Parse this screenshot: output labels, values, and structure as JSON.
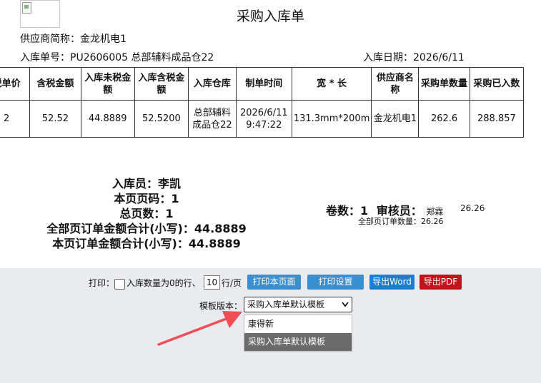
{
  "title": "采购入库单",
  "supplier_line": "供应商简称：金龙机电1",
  "order_line": "入库单号：PU2606005 总部辅料成品仓22",
  "date_line": "入库日期：2026/6/11",
  "table": {
    "headers": [
      "税单价",
      "含税金额",
      "入库未税金额",
      "入库含税金额",
      "入库仓库",
      "制单时间",
      "宽 * 长",
      "供应商名称",
      "采购单数量",
      "采购已入数"
    ],
    "row": [
      "2",
      "52.52",
      "44.8889",
      "52.5200",
      "总部辅料成品仓22",
      "2026/6/11 9:47:22",
      "131.3mm*200m",
      "金龙机电1",
      "262.6",
      "288.857"
    ]
  },
  "summary": {
    "receiver": "入库员：李凯",
    "page_no": "本页页码：1",
    "page_total": "总页数：1",
    "all_total": "全部页订单金额合计(小写)：44.8889",
    "page_total_amount": "本页订单金额合计(小写)：44.8889",
    "rolls_label": "卷数：",
    "rolls_value": "1",
    "auditor_label": "审核员：",
    "auditor_name": "郑霖",
    "auditor_num": "26.26",
    "all_qty": "全部页订单数量：26.26"
  },
  "controls": {
    "print_label": "打印：",
    "zero_label": "入库数量为0的行、",
    "rows_value": "10",
    "rows_suffix": "行/页",
    "btn_print_page": "打印本页面",
    "btn_print_settings": "打印设置",
    "btn_export_word": "导出Word",
    "btn_export_pdf": "导出PDF",
    "template_label": "模板版本：",
    "template_selected": "采购入库单默认模板",
    "options": [
      "康得新",
      "采购入库单默认模板"
    ]
  },
  "colors": {
    "panel_bg": "#e9ebee",
    "btn_blue": "#3a8fd0",
    "btn_word": "#1a7ed6",
    "btn_pdf": "#c0131c",
    "arrow": "#f04e55",
    "option_selected": "#6b6b6b"
  }
}
